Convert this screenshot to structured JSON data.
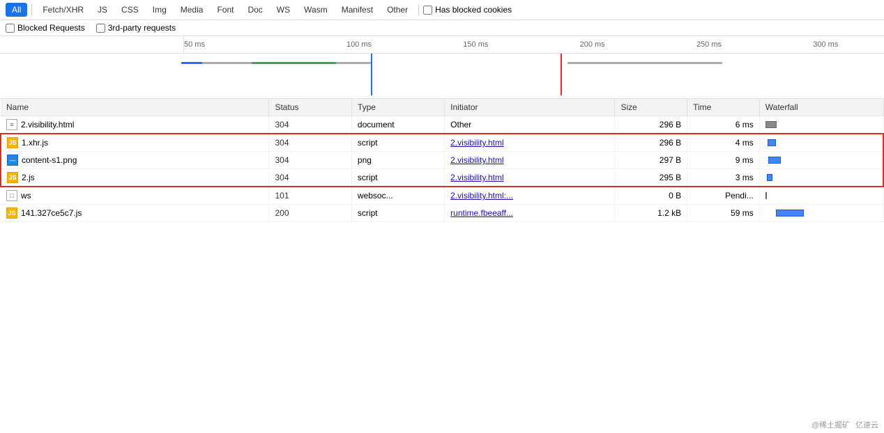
{
  "filters": {
    "buttons": [
      {
        "label": "All",
        "active": true
      },
      {
        "label": "Fetch/XHR",
        "active": false
      },
      {
        "label": "JS",
        "active": false
      },
      {
        "label": "CSS",
        "active": false
      },
      {
        "label": "Img",
        "active": false
      },
      {
        "label": "Media",
        "active": false
      },
      {
        "label": "Font",
        "active": false
      },
      {
        "label": "Doc",
        "active": false
      },
      {
        "label": "WS",
        "active": false
      },
      {
        "label": "Wasm",
        "active": false
      },
      {
        "label": "Manifest",
        "active": false
      },
      {
        "label": "Other",
        "active": false
      }
    ],
    "has_blocked_cookies_label": "Has blocked cookies",
    "blocked_requests_label": "Blocked Requests",
    "third_party_label": "3rd-party requests"
  },
  "timeline": {
    "marks": [
      "50 ms",
      "100 ms",
      "150 ms",
      "200 ms",
      "250 ms",
      "300 ms"
    ]
  },
  "table": {
    "headers": [
      "Name",
      "Status",
      "Type",
      "Initiator",
      "Size",
      "Time",
      "Waterfall"
    ],
    "rows": [
      {
        "name": "2.visibility.html",
        "icon": "doc",
        "status": "304",
        "type": "document",
        "initiator": "Other",
        "initiator_link": false,
        "size": "296 B",
        "time": "6 ms",
        "in_group": false
      },
      {
        "name": "1.xhr.js",
        "icon": "script",
        "status": "304",
        "type": "script",
        "initiator": "2.visibility.html",
        "initiator_link": true,
        "size": "296 B",
        "time": "4 ms",
        "in_group": true,
        "group_pos": "top"
      },
      {
        "name": "content-s1.png",
        "icon": "img",
        "status": "304",
        "type": "png",
        "initiator": "2.visibility.html",
        "initiator_link": true,
        "size": "297 B",
        "time": "9 ms",
        "in_group": true,
        "group_pos": "middle"
      },
      {
        "name": "2.js",
        "icon": "script",
        "status": "304",
        "type": "script",
        "initiator": "2.visibility.html",
        "initiator_link": true,
        "size": "295 B",
        "time": "3 ms",
        "in_group": true,
        "group_pos": "bottom"
      },
      {
        "name": "ws",
        "icon": "ws",
        "status": "101",
        "type": "websoc...",
        "initiator": "2.visibility.html:...",
        "initiator_link": true,
        "size": "0 B",
        "time": "Pendi...",
        "in_group": false
      },
      {
        "name": "141.327ce5c7.js",
        "icon": "script",
        "status": "200",
        "type": "script",
        "initiator": "runtime.fbeeaff...",
        "initiator_link": true,
        "size": "1.2 kB",
        "time": "59 ms",
        "in_group": false
      }
    ]
  },
  "watermark": {
    "text1": "@稀土掘矿",
    "text2": "亿速云"
  }
}
